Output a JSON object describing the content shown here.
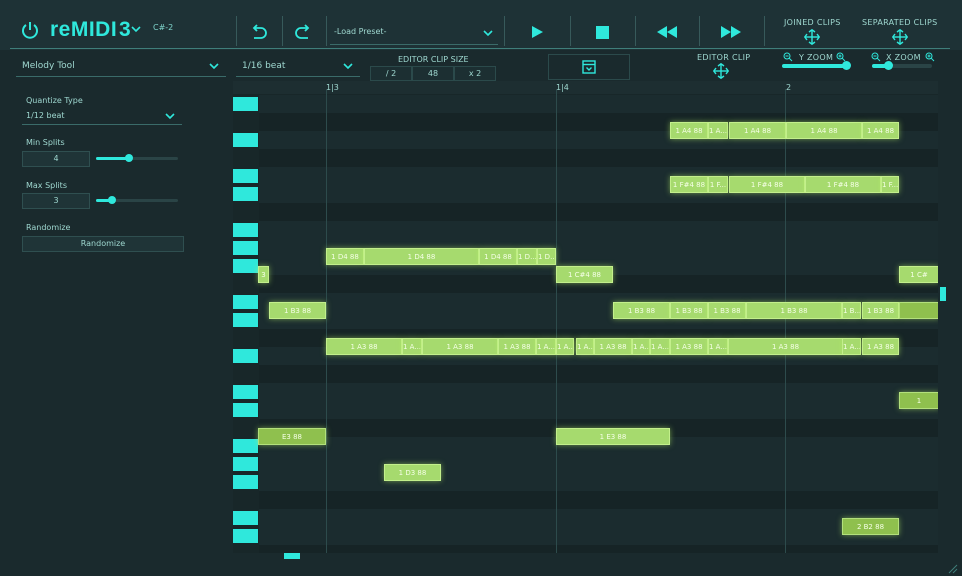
{
  "app": {
    "name": "reMIDI",
    "version": "3",
    "key": "C#-2"
  },
  "toolbar": {
    "preset_placeholder": "-Load Preset-",
    "joined_clips": "JOINED CLIPS",
    "separated_clips": "SEPARATED CLIPS"
  },
  "row2": {
    "tool": "Melody Tool",
    "beat": "1/16 beat",
    "editor_clip_size": "EDITOR CLIP SIZE",
    "size_div": "/ 2",
    "size_value": "48",
    "size_mul": "x 2",
    "editor_clip": "EDITOR CLIP",
    "y_zoom": "Y ZOOM",
    "x_zoom": "X ZOOM"
  },
  "left_panel": {
    "quantize_label": "Quantize Type",
    "quantize_value": "1/12 beat",
    "min_splits_label": "Min Splits",
    "min_splits_value": "4",
    "min_splits_level": 0.4,
    "max_splits_label": "Max Splits",
    "max_splits_value": "3",
    "max_splits_level": 0.2,
    "randomize_label": "Randomize",
    "randomize_button": "Randomize"
  },
  "ruler": [
    "1|3",
    "1|4",
    "2"
  ],
  "notes": [
    {
      "label": "1 A4 88"
    },
    {
      "label": "1 A..."
    },
    {
      "label": "1 A4 88"
    },
    {
      "label": "1 A4 88"
    },
    {
      "label": "1 A4 88"
    },
    {
      "label": "1 F#4 88"
    },
    {
      "label": "1 F..."
    },
    {
      "label": "1 F#4 88"
    },
    {
      "label": "1 F#4 88"
    },
    {
      "label": "1 F..."
    },
    {
      "label": "1 D4 88"
    },
    {
      "label": "1 D4 88"
    },
    {
      "label": "1 D4 88"
    },
    {
      "label": "1 D..."
    },
    {
      "label": "1 D..."
    },
    {
      "label": "3"
    },
    {
      "label": "1 C#4 88"
    },
    {
      "label": "1 C#"
    },
    {
      "label": "1 B3 88"
    },
    {
      "label": "1 B3 88"
    },
    {
      "label": "1 B3 88"
    },
    {
      "label": "1 B3 88"
    },
    {
      "label": "1 B3 88"
    },
    {
      "label": "1 B..."
    },
    {
      "label": "1 B3 88"
    },
    {
      "label": ""
    },
    {
      "label": "1 A3 88"
    },
    {
      "label": "1 A..."
    },
    {
      "label": "1 A3 88"
    },
    {
      "label": "1 A3 88"
    },
    {
      "label": "1 A..."
    },
    {
      "label": "1 A..."
    },
    {
      "label": "1 A..."
    },
    {
      "label": "1 A3 88"
    },
    {
      "label": "1 A..."
    },
    {
      "label": "1 A..."
    },
    {
      "label": "1 A3 88"
    },
    {
      "label": "1 A..."
    },
    {
      "label": "1 A3 88"
    },
    {
      "label": "1 A..."
    },
    {
      "label": "1 A3 88"
    },
    {
      "label": "1"
    },
    {
      "label": "E3 88"
    },
    {
      "label": "1 E3 88"
    },
    {
      "label": "1 D3 88"
    },
    {
      "label": "2 B2 88"
    }
  ],
  "colors": {
    "accent": "#2fe8dc",
    "note": "#a6da6e",
    "background": "#1a2a2d"
  },
  "icons": {
    "power": "power-icon",
    "undo": "undo-icon",
    "redo": "redo-icon",
    "play": "play-icon",
    "stop": "stop-icon",
    "rewind": "rewind-icon",
    "fast_forward": "fast-forward-icon",
    "move": "move-icon",
    "zoom_in": "zoom-in-icon",
    "zoom_out": "zoom-out-icon"
  }
}
